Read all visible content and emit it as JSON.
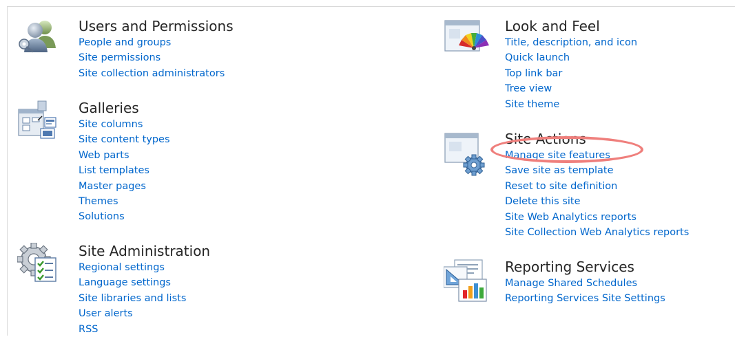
{
  "sections": {
    "users": {
      "title": "Users and Permissions",
      "links": [
        "People and groups",
        "Site permissions",
        "Site collection administrators"
      ]
    },
    "galleries": {
      "title": "Galleries",
      "links": [
        "Site columns",
        "Site content types",
        "Web parts",
        "List templates",
        "Master pages",
        "Themes",
        "Solutions"
      ]
    },
    "siteadmin": {
      "title": "Site Administration",
      "links": [
        "Regional settings",
        "Language settings",
        "Site libraries and lists",
        "User alerts",
        "RSS"
      ]
    },
    "lookfeel": {
      "title": "Look and Feel",
      "links": [
        "Title, description, and icon",
        "Quick launch",
        "Top link bar",
        "Tree view",
        "Site theme"
      ]
    },
    "siteactions": {
      "title": "Site Actions",
      "links": [
        "Manage site features",
        "Save site as template",
        "Reset to site definition",
        "Delete this site",
        "Site Web Analytics reports",
        "Site Collection Web Analytics reports"
      ]
    },
    "reporting": {
      "title": "Reporting Services",
      "links": [
        "Manage Shared Schedules",
        "Reporting Services Site Settings"
      ]
    }
  },
  "colors": {
    "link": "#0066cc",
    "heading": "#262626",
    "highlight": "#ef7f7c"
  },
  "icons": {
    "users": "users-permissions-icon",
    "galleries": "galleries-icon",
    "siteadmin": "site-administration-icon",
    "lookfeel": "look-and-feel-icon",
    "siteactions": "site-actions-icon",
    "reporting": "reporting-services-icon"
  },
  "annotation": {
    "highlighted_link": "Manage site features"
  }
}
